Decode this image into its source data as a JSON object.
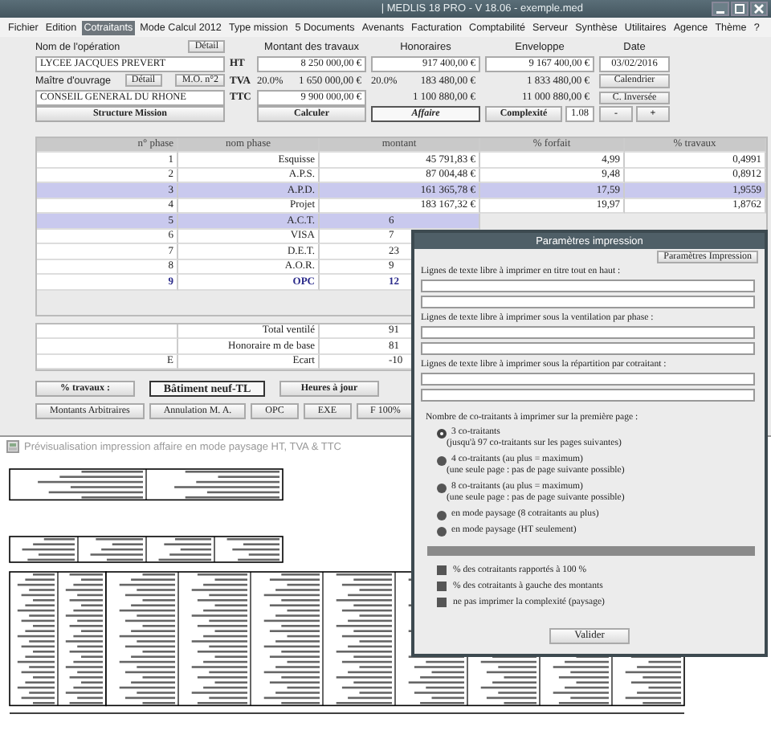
{
  "window": {
    "title": "| MEDLIS 18 PRO - V 18.06 - exemple.med"
  },
  "menu": [
    {
      "label": "Fichier",
      "selected": false
    },
    {
      "label": "Edition",
      "selected": false
    },
    {
      "label": "Cotraitants",
      "selected": true
    },
    {
      "label": "Mode Calcul 2012",
      "selected": false
    },
    {
      "label": "Type mission",
      "selected": false
    },
    {
      "label": "5 Documents",
      "selected": false
    },
    {
      "label": "Avenants",
      "selected": false
    },
    {
      "label": "Facturation",
      "selected": false
    },
    {
      "label": "Comptabilité",
      "selected": false
    },
    {
      "label": "Serveur",
      "selected": false
    },
    {
      "label": "Synthèse",
      "selected": false
    },
    {
      "label": "Utilitaires",
      "selected": false
    },
    {
      "label": "Agence",
      "selected": false
    },
    {
      "label": "Thème",
      "selected": false
    },
    {
      "label": "?",
      "selected": false
    }
  ],
  "operation": {
    "name_label": "Nom de l'opération",
    "name_detail": "Détail",
    "name_value": "LYCEE JACQUES PREVERT",
    "owner_label": "Maître d'ouvrage",
    "owner_detail": "Détail",
    "owner_mo": "M.O. n°2",
    "owner_value": "CONSEIL GENERAL DU RHONE",
    "structure": "Structure Mission"
  },
  "amounts": {
    "row_labels": [
      "HT",
      "TVA",
      "TTC"
    ],
    "columns": [
      {
        "heading": "Montant des travaux",
        "ht": "8 250 000,00 €",
        "tva_rate": "20.0%",
        "tva": "1 650 000,00 €",
        "ttc": "9 900 000,00 €"
      },
      {
        "heading": "Honoraires",
        "ht": "917 400,00 €",
        "tva_rate": "20.0%",
        "tva": "183 480,00 €",
        "ttc": "1 100 880,00 €"
      },
      {
        "heading": "Enveloppe",
        "ht": "9 167 400,00 €",
        "tva": "1 833 480,00 €",
        "ttc": "11 000 880,00 €"
      }
    ]
  },
  "date": {
    "label": "Date",
    "value": "03/02/2016",
    "calendar": "Calendrier",
    "inverse": "C. Inversée",
    "minus": "-",
    "plus": "+"
  },
  "actions": {
    "calculate": "Calculer",
    "affaire": "Affaire",
    "complexity": "Complexité",
    "complexity_value": "1.08"
  },
  "phases": {
    "columns": [
      "n° phase",
      "nom phase",
      "montant",
      "% forfait",
      "% travaux"
    ],
    "rows": [
      {
        "num": "1",
        "name": "Esquisse",
        "amount": "45 791,83 €",
        "forfait": "4,99",
        "travaux": "0,4991",
        "selected": false,
        "bold": false
      },
      {
        "num": "2",
        "name": "A.P.S.",
        "amount": "87 004,48 €",
        "forfait": "9,48",
        "travaux": "0,8912",
        "selected": false,
        "bold": false
      },
      {
        "num": "3",
        "name": "A.P.D.",
        "amount": "161 365,78 €",
        "forfait": "17,59",
        "travaux": "1,9559",
        "selected": true,
        "bold": false
      },
      {
        "num": "4",
        "name": "Projet",
        "amount": "183 167,32 €",
        "forfait": "19,97",
        "travaux": "1,8762",
        "selected": false,
        "bold": false
      },
      {
        "num": "5",
        "name": "A.C.T.",
        "amount": "6",
        "selected": true,
        "bold": false
      },
      {
        "num": "6",
        "name": "VISA",
        "amount": "7",
        "selected": false,
        "bold": false
      },
      {
        "num": "7",
        "name": "D.E.T.",
        "amount": "23",
        "selected": false,
        "bold": false
      },
      {
        "num": "8",
        "name": "A.O.R.",
        "amount": "9",
        "selected": false,
        "bold": false
      },
      {
        "num": "9",
        "name": "OPC",
        "amount": "12",
        "selected": false,
        "bold": true
      }
    ]
  },
  "totals": [
    {
      "label": "Total ventilé",
      "value": "91"
    },
    {
      "label": "Honoraire m de base",
      "value": "81"
    },
    {
      "marker": "E",
      "label": "Ecart",
      "value": "-10"
    }
  ],
  "buttons_row1": [
    {
      "label": "% travaux :",
      "selected": false
    },
    {
      "label": "Bâtiment neuf-TL",
      "selected": true
    },
    {
      "label": "Heures à jour",
      "selected": false
    }
  ],
  "buttons_row2": [
    "Montants Arbitraires",
    "Annulation M. A.",
    "OPC",
    "EXE",
    "F 100%"
  ],
  "preview": {
    "title": "Prévisualisation impression affaire en mode paysage HT, TVA & TTC"
  },
  "dialog": {
    "title": "Paramètres impression",
    "top_button": "Paramètres Impression",
    "line_groups": [
      {
        "label": "Lignes de texte libre à imprimer en titre tout en haut :"
      },
      {
        "label": "Lignes de texte libre à imprimer sous la ventilation par phase :"
      },
      {
        "label": "Lignes de texte libre à imprimer sous la répartition par cotraitant :"
      }
    ],
    "radio_label": "Nombre de co-traitants à imprimer sur la première page :",
    "radios": [
      {
        "label": "3 co-traitants",
        "note": "(jusqu'à 97 co-traitants sur les pages suivantes)",
        "selected": true
      },
      {
        "label": "4 co-traitants (au plus = maximum)",
        "note": "(une seule page : pas de page suivante possible)",
        "selected": false
      },
      {
        "label": "8 co-traitants (au plus = maximum)",
        "note": "(une seule page : pas de page suivante possible)",
        "selected": false
      },
      {
        "label": "en mode paysage (8 cotraitants au plus)",
        "selected": false
      },
      {
        "label": "en mode paysage (HT seulement)",
        "selected": false
      }
    ],
    "checkboxes": [
      {
        "label": "% des cotraitants rapportés à 100 %",
        "checked": false
      },
      {
        "label": "% des cotraitants à gauche des montants",
        "checked": false
      },
      {
        "label": "ne pas imprimer la complexité (paysage)",
        "checked": false
      }
    ],
    "validate": "Valider"
  }
}
